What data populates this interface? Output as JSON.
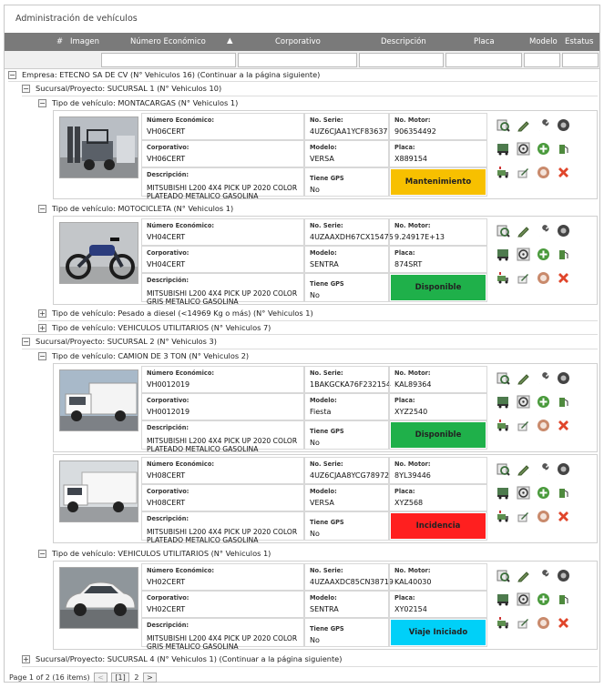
{
  "title": "Administración de vehículos",
  "columns": {
    "hash": "#",
    "image": "Imagen",
    "economic_number": "Número Económico",
    "corporate": "Corporativo",
    "description": "Descripción",
    "plate": "Placa",
    "model": "Modelo",
    "status": "Estatus"
  },
  "groups": {
    "empresa": "Empresa: ETECNO SA DE CV (N° Vehiculos 16) (Continuar a la página siguiente)",
    "suc1": "Sucursal/Proyecto: SUCURSAL 1 (N° Vehiculos 10)",
    "t_montacargas": "Tipo de vehículo: MONTACARGAS (N° Vehiculos 1)",
    "t_moto": "Tipo de vehículo: MOTOCICLETA (N° Vehiculos 1)",
    "t_diesel": "Tipo de vehículo: Pesado a diesel (<14969 Kg o más) (N° Vehiculos 1)",
    "t_util1": "Tipo de vehículo: VEHICULOS UTILITARIOS (N° Vehiculos 7)",
    "suc2": "Sucursal/Proyecto: SUCURSAL 2 (N° Vehiculos 3)",
    "t_camion": "Tipo de vehículo: CAMION DE 3 TON (N° Vehiculos 2)",
    "t_util2": "Tipo de vehículo: VEHICULOS UTILITARIOS (N° Vehiculos 1)",
    "suc4": "Sucursal/Proyecto: SUCURSAL 4 (N° Vehiculos 1) (Continuar a la página siguiente)"
  },
  "labels": {
    "economic": "Número Económico:",
    "serie": "No. Serie:",
    "motor": "No. Motor:",
    "corporate": "Corporativo:",
    "model": "Modelo:",
    "plate": "Placa:",
    "description": "Descripción:",
    "gps": "Tiene GPS"
  },
  "vehicles": [
    {
      "economic": "VH06CERT",
      "serie": "4UZ6CJAA1YCF83637",
      "motor": "906354492",
      "corporate": "VH06CERT",
      "model": "VERSA",
      "plate": "X889154",
      "desc1": "MITSUBISHI L200 4X4 PICK UP 2020 COLOR",
      "desc2": "PLATEADO METALICO GASOLINA",
      "gps": "No",
      "status": "Mantenimiento",
      "status_color": "#f7c000",
      "photo": "forklift"
    },
    {
      "economic": "VH04CERT",
      "serie": "4UZAAXDH67CX15475",
      "motor": "9.24917E+13",
      "corporate": "VH04CERT",
      "model": "SENTRA",
      "plate": "874SRT",
      "desc1": "MITSUBISHI L200 4X4 PICK UP 2020 COLOR",
      "desc2": "GRIS METALICO GASOLINA",
      "gps": "No",
      "status": "Disponible",
      "status_color": "#1fb04a",
      "photo": "motorcycle"
    },
    {
      "economic": "VH0012019",
      "serie": "1BAKGCKA76F232154",
      "motor": "KAL89364",
      "corporate": "VH0012019",
      "model": "Fiesta",
      "plate": "XYZ2540",
      "desc1": "MITSUBISHI L200 4X4 PICK UP 2020 COLOR",
      "desc2": "PLATEADO METALICO GASOLINA",
      "gps": "No",
      "status": "Disponible",
      "status_color": "#1fb04a",
      "photo": "truck"
    },
    {
      "economic": "VH08CERT",
      "serie": "4UZ6CJAA8YCG78972",
      "motor": "8YL39446",
      "corporate": "VH08CERT",
      "model": "VERSA",
      "plate": "XYZ568",
      "desc1": "MITSUBISHI L200 4X4 PICK UP 2020 COLOR",
      "desc2": "PLATEADO METALICO GASOLINA",
      "gps": "No",
      "status": "Incidencia",
      "status_color": "#ff1f1f",
      "photo": "truck2"
    },
    {
      "economic": "VH02CERT",
      "serie": "4UZAAXDC85CN38719",
      "motor": "KAL40030",
      "corporate": "VH02CERT",
      "model": "SENTRA",
      "plate": "XY02154",
      "desc1": "MITSUBISHI L200 4X4 PICK UP 2020 COLOR",
      "desc2": "GRIS METALICO GASOLINA",
      "gps": "No",
      "status": "Viaje Iniciado",
      "status_color": "#00d0f8",
      "photo": "car"
    }
  ],
  "icons": [
    "search-list-icon",
    "pencil-icon",
    "wrench-icon",
    "tire-icon",
    "truck-list-icon",
    "steering-wheel-icon",
    "add-icon",
    "fuel-icon",
    "chart-truck-icon",
    "pen-paper-icon",
    "disable-icon",
    "delete-icon"
  ],
  "footer": {
    "info": "Page 1 of 2 (16 items)",
    "prev": "<",
    "page1": "[1]",
    "page2": "2",
    "next": ">"
  }
}
